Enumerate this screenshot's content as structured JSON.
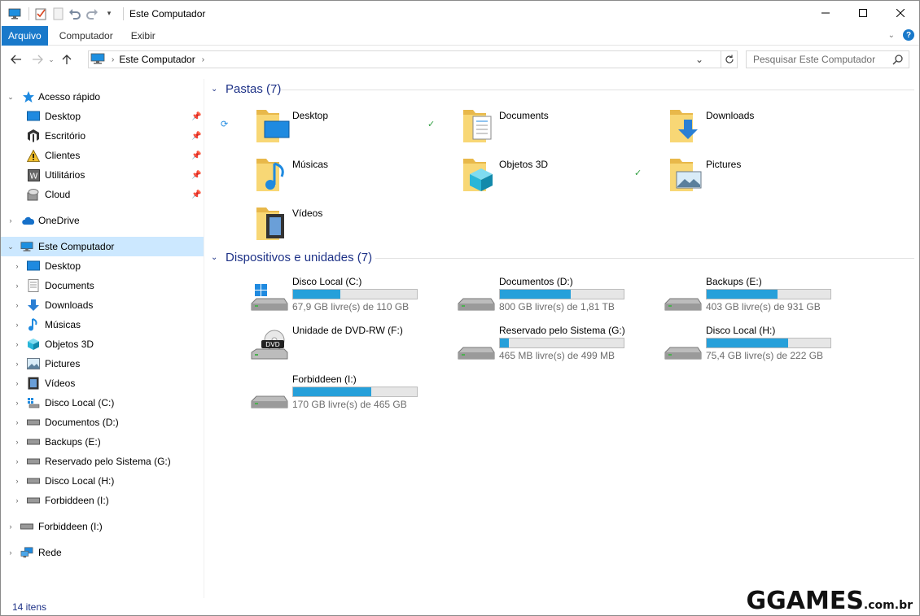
{
  "window": {
    "title": "Este Computador"
  },
  "ribbon": {
    "tabs": [
      "Arquivo",
      "Computador",
      "Exibir"
    ]
  },
  "address": {
    "crumb": "Este Computador",
    "search_placeholder": "Pesquisar Este Computador"
  },
  "nav": {
    "quick_access": "Acesso rápido",
    "quick_items": [
      "Desktop",
      "Escritório",
      "Clientes",
      "Utilitários",
      "Cloud"
    ],
    "onedrive": "OneDrive",
    "this_pc": "Este Computador",
    "pc_items": [
      "Desktop",
      "Documents",
      "Downloads",
      "Músicas",
      "Objetos 3D",
      "Pictures",
      "Vídeos",
      "Disco Local (C:)",
      "Documentos (D:)",
      "Backups (E:)",
      "Reservado pelo Sistema (G:)",
      "Disco Local (H:)",
      "Forbiddeen (I:)"
    ],
    "forbiddeen": "Forbiddeen (I:)",
    "network": "Rede"
  },
  "folders": {
    "header": "Pastas (7)",
    "items": [
      "Desktop",
      "Documents",
      "Downloads",
      "Músicas",
      "Objetos 3D",
      "Pictures",
      "Vídeos"
    ]
  },
  "devices": {
    "header": "Dispositivos e unidades (7)",
    "items": [
      {
        "name": "Disco Local (C:)",
        "free": "67,9 GB livre(s) de 110 GB",
        "used_fraction": 0.38
      },
      {
        "name": "Documentos (D:)",
        "free": "800 GB livre(s) de 1,81 TB",
        "used_fraction": 0.57
      },
      {
        "name": "Backups (E:)",
        "free": "403 GB livre(s) de 931 GB",
        "used_fraction": 0.57
      },
      {
        "name": "Unidade de DVD-RW (F:)",
        "free": "",
        "used_fraction": null
      },
      {
        "name": "Reservado pelo Sistema (G:)",
        "free": "465 MB livre(s) de 499 MB",
        "used_fraction": 0.07
      },
      {
        "name": "Disco Local (H:)",
        "free": "75,4 GB livre(s) de 222 GB",
        "used_fraction": 0.66
      },
      {
        "name": "Forbiddeen (I:)",
        "free": "170 GB livre(s) de 465 GB",
        "used_fraction": 0.63
      }
    ]
  },
  "status": {
    "count": "14 itens"
  },
  "watermark": {
    "text": "GGAMES",
    "suffix": ".com.br"
  },
  "colors": {
    "accent": "#1979ca",
    "header": "#1e3287",
    "drive_bar": "#26a0da",
    "selection": "#cce8ff"
  }
}
